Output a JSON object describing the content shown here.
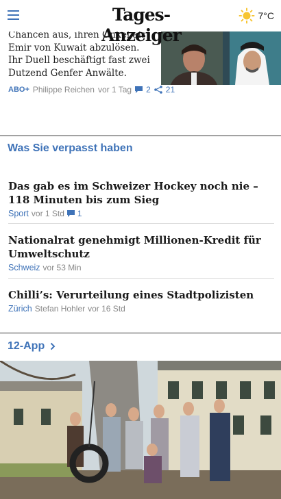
{
  "header": {
    "logo_text": "Tages-Anzeiger",
    "weather_icon": "sun-icon",
    "temperature": "7°C"
  },
  "top_article": {
    "teaser_lines": [
      "Chancen aus, ihren Onkel als",
      "Emir von Kuwait abzulösen.",
      "Ihr Duell beschäftigt fast zwei",
      "Dutzend Genfer Anwälte."
    ],
    "badge": "ABO+",
    "author": "Philippe Reichen",
    "time": "vor 1 Tag",
    "comments": "2",
    "shares": "21"
  },
  "missed_section": {
    "title": "Was Sie verpasst haben",
    "items": [
      {
        "headline": "Das gab es im Schweizer Hockey noch nie – 118 Minuten bis zum Sieg",
        "category": "Sport",
        "time": "vor 1 Std",
        "comments": "1"
      },
      {
        "headline": "Nationalrat genehmigt Millionen-Kredit für Umweltschutz",
        "category": "Schweiz",
        "time": "vor 53 Min"
      },
      {
        "headline": "Chilli’s: Verurteilung eines Stadtpolizisten",
        "category": "Zürich",
        "author": "Stefan Hohler",
        "time": "vor 16 Std"
      }
    ]
  },
  "app_section": {
    "label": "12-App"
  },
  "colors": {
    "accent": "#3f73b8",
    "sun": "#f7c531"
  }
}
